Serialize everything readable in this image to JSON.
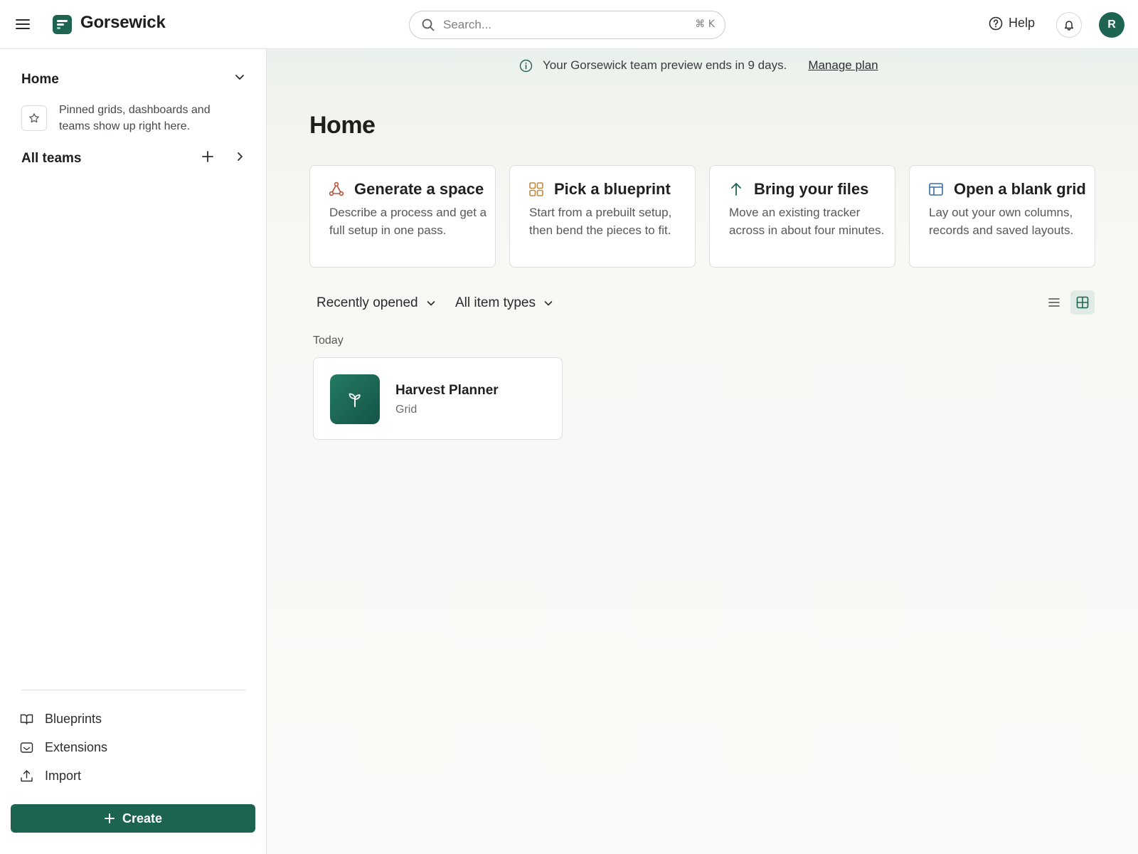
{
  "app": {
    "name": "Gorsewick"
  },
  "header": {
    "search_placeholder": "Search...",
    "search_shortcut": "⌘ K",
    "help_label": "Help",
    "avatar_initial": "R"
  },
  "sidebar": {
    "home_label": "Home",
    "pinned_hint": "Pinned grids, dashboards and teams show up right here.",
    "all_teams_label": "All teams",
    "links": [
      {
        "label": "Blueprints",
        "icon": "book-icon"
      },
      {
        "label": "Extensions",
        "icon": "extensions-icon"
      },
      {
        "label": "Import",
        "icon": "upload-icon"
      }
    ],
    "create_label": "Create"
  },
  "banner": {
    "text": "Your Gorsewick team preview ends in 9 days.",
    "link": "Manage plan"
  },
  "main": {
    "title": "Home",
    "cards": [
      {
        "title": "Generate a space",
        "desc": "Describe a process and get a full setup in one pass.",
        "icon": "nodes-icon",
        "icon_color": "#b5533b"
      },
      {
        "title": "Pick a blueprint",
        "desc": "Start from a prebuilt setup, then bend the pieces to fit.",
        "icon": "blueprint-grid-icon",
        "icon_color": "#c1893e"
      },
      {
        "title": "Bring your files",
        "desc": "Move an existing tracker across in about four minutes.",
        "icon": "arrow-up-icon",
        "icon_color": "#1d6453"
      },
      {
        "title": "Open a blank grid",
        "desc": "Lay out your own columns, records and saved layouts.",
        "icon": "layout-icon",
        "icon_color": "#3a6ea5"
      }
    ],
    "filters": {
      "sort_label": "Recently opened",
      "type_label": "All item types"
    },
    "section_label": "Today",
    "items": [
      {
        "name": "Harvest Planner",
        "type": "Grid",
        "icon": "sprout-icon",
        "color": "#1d6453"
      }
    ]
  },
  "colors": {
    "accent": "#1c6352",
    "background": "#f9f9f7",
    "border": "#dcdfdd"
  }
}
